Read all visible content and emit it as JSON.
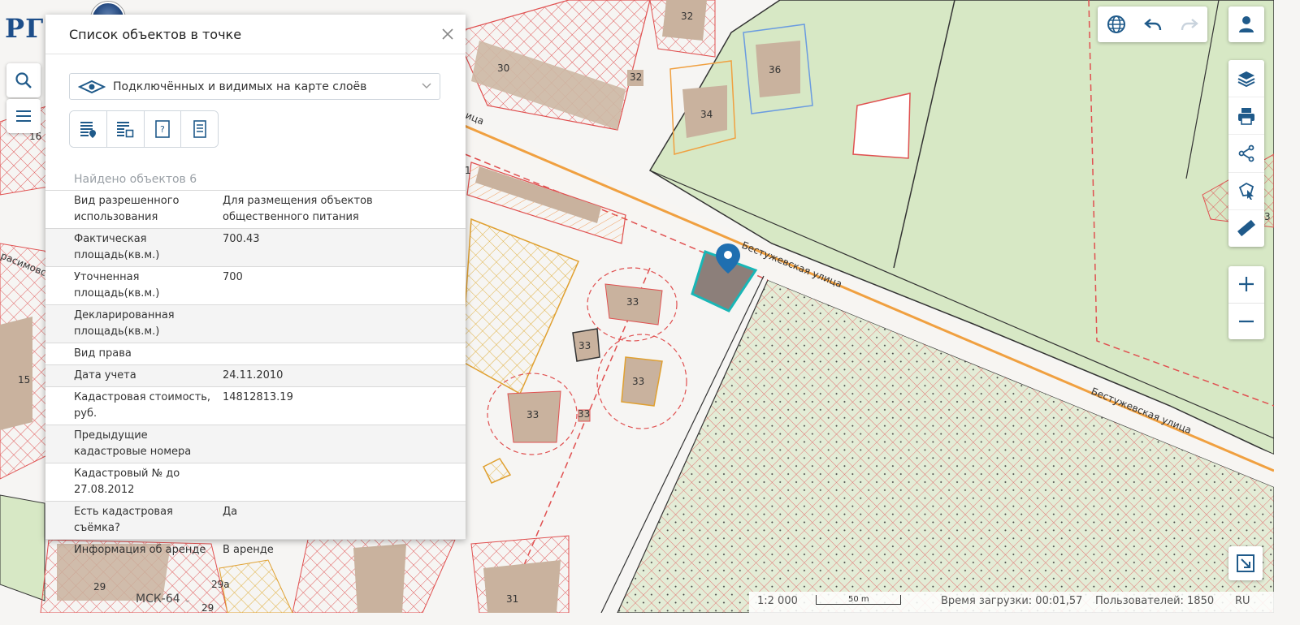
{
  "logo": {
    "text": "РГ"
  },
  "panel": {
    "title": "Список объектов в точке",
    "layer_select": "Подключённых и видимых на карте слоёв",
    "found": "Найдено объектов 6",
    "modes": [
      "list-pin-icon",
      "list-area-icon",
      "frame-question-icon",
      "document-icon"
    ],
    "attributes": [
      {
        "key": "Вид разрешенного использования",
        "value": "Для размещения объектов общественного питания"
      },
      {
        "key": "Фактическая площадь(кв.м.)",
        "value": "700.43"
      },
      {
        "key": "Уточненная площадь(кв.м.)",
        "value": "700"
      },
      {
        "key": "Декларированная площадь(кв.м.)",
        "value": ""
      },
      {
        "key": "Вид права",
        "value": ""
      },
      {
        "key": "Дата учета",
        "value": "24.11.2010"
      },
      {
        "key": "Кадастровая стоимость, руб.",
        "value": "14812813.19"
      },
      {
        "key": "Предыдущие кадастровые номера",
        "value": ""
      },
      {
        "key": "Кадастровый № до 27.08.2012",
        "value": ""
      },
      {
        "key": "Есть кадастровая съёмка?",
        "value": "Да"
      },
      {
        "key": "Информация об аренде",
        "value": "В аренде"
      }
    ]
  },
  "map": {
    "street_labels": [
      "Бестужевская улица",
      "Бестужевская улица",
      "расимовс",
      "ица"
    ],
    "house_numbers": [
      "30",
      "32",
      "32",
      "36",
      "34",
      "33",
      "33",
      "33",
      "33",
      "33",
      "15",
      "29",
      "29а",
      "29",
      "31",
      "1",
      "16",
      "3"
    ]
  },
  "footer": {
    "crs": "МСК-64",
    "scale": "1:2 000",
    "scalebar_label": "50 m",
    "load_time": "Время загрузки: 00:01,57",
    "users": "Пользователей: 1850",
    "lang": "RU"
  },
  "colors": {
    "accent": "#1f5a8a",
    "selection": "#19b6b6",
    "parcel_red": "#e05050",
    "green_zone": "#d7e8c5",
    "road_orange": "#f0a040"
  }
}
